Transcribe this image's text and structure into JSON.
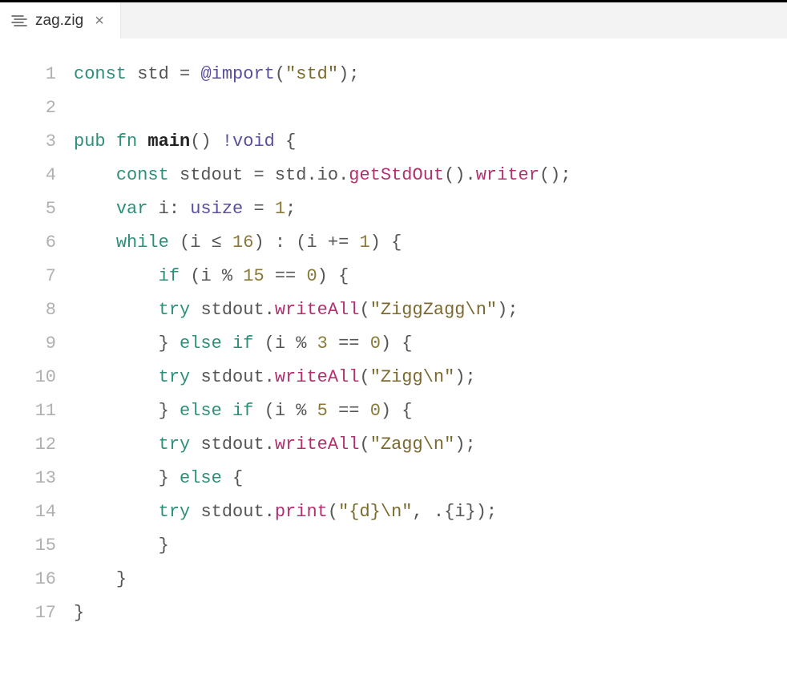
{
  "tab": {
    "filename": "zag.zig",
    "close_glyph": "×"
  },
  "gutter": {
    "l1": "1",
    "l2": "2",
    "l3": "3",
    "l4": "4",
    "l5": "5",
    "l6": "6",
    "l7": "7",
    "l8": "8",
    "l9": "9",
    "l10": "10",
    "l11": "11",
    "l12": "12",
    "l13": "13",
    "l14": "14",
    "l15": "15",
    "l16": "16",
    "l17": "17"
  },
  "tok": {
    "kw_const": "const",
    "kw_pub": "pub",
    "kw_fn": "fn",
    "kw_var": "var",
    "kw_while": "while",
    "kw_if": "if",
    "kw_else": "else",
    "kw_try": "try",
    "ident_std": "std",
    "ident_i": "i",
    "ident_stdout": "stdout",
    "ident_io": "io",
    "def_main": "main",
    "builtin_import": "@import",
    "type_bangvoid": "!void",
    "type_usize": "usize",
    "fn_getStdOut": "getStdOut",
    "fn_writer": "writer",
    "fn_writeAll": "writeAll",
    "fn_print": "print",
    "str_std": "\"std\"",
    "str_ziggzagg": "\"ZiggZagg\\n\"",
    "str_zigg": "\"Zigg\\n\"",
    "str_zagg": "\"Zagg\\n\"",
    "str_fmt": "\"{d}\\n\"",
    "num_1": "1",
    "num_16": "16",
    "num_15": "15",
    "num_3": "3",
    "num_5": "5",
    "num_0": "0",
    "op_assign": " = ",
    "op_colon_sp": ": ",
    "op_le": " ≤ ",
    "op_pluseq": " += ",
    "op_mod": " % ",
    "op_eqeq": " == ",
    "p_lparen": "(",
    "p_rparen": ")",
    "p_lbrace": "{",
    "p_rbrace": "}",
    "p_semi": ";",
    "p_dot": ".",
    "p_comma_sp": ", ",
    "p_colon_sep": " : ",
    "p_empty_parens": "()",
    "p_args_open": ".{",
    "sp": " ",
    "ind1": "    ",
    "ind2": "        ",
    "ind3": "        "
  }
}
